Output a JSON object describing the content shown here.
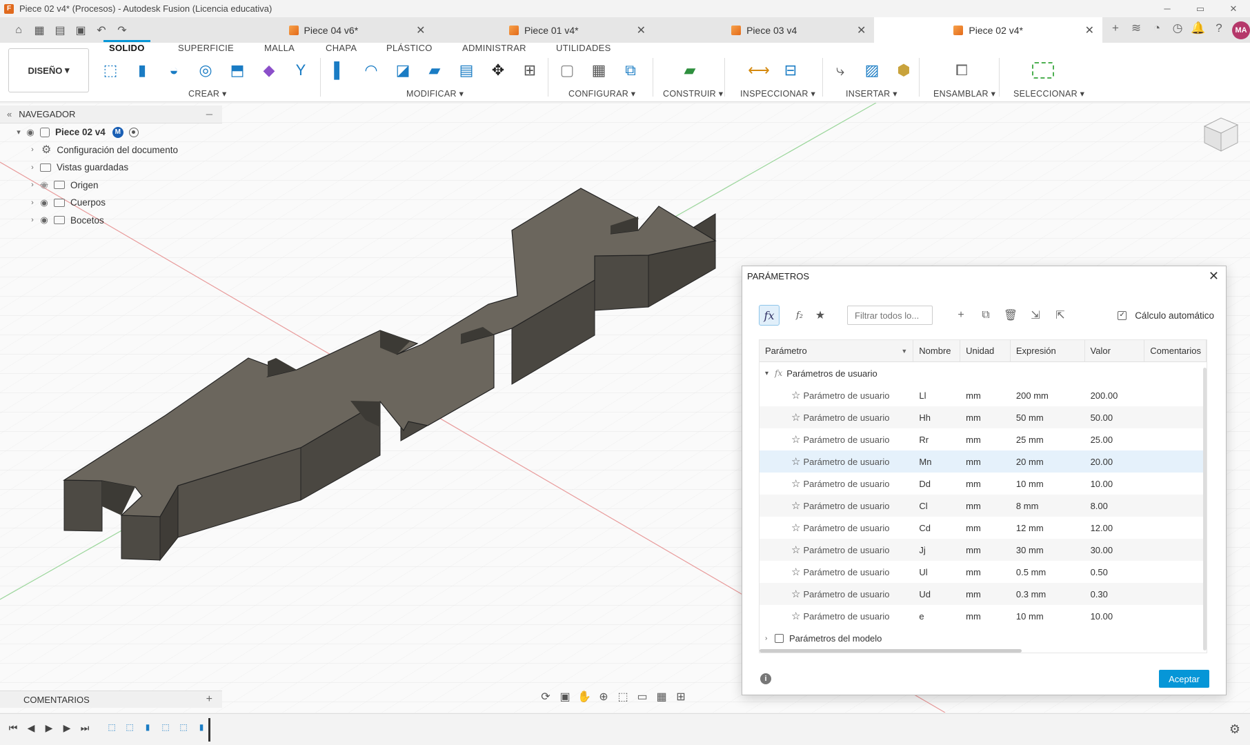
{
  "window": {
    "title": "Piece 02 v4* (Procesos) - Autodesk Fusion (Licencia educativa)",
    "min": "─",
    "max": "▭",
    "close": "✕"
  },
  "tabs": [
    {
      "label": "Piece 04 v6*"
    },
    {
      "label": "Piece 01 v4*"
    },
    {
      "label": "Piece 03 v4"
    },
    {
      "label": "Piece 02 v4*"
    }
  ],
  "user": {
    "initials": "MA"
  },
  "toolbar": {
    "workspace": "DISEÑO",
    "tabs": [
      "SOLIDO",
      "SUPERFICIE",
      "MALLA",
      "CHAPA",
      "PLÁSTICO",
      "ADMINISTRAR",
      "UTILIDADES"
    ],
    "groups": [
      "CREAR",
      "MODIFICAR",
      "CONFIGURAR",
      "CONSTRUIR",
      "INSPECCIONAR",
      "INSERTAR",
      "ENSAMBLAR",
      "SELECCIONAR"
    ]
  },
  "navigator": {
    "title": "NAVEGADOR",
    "root": "Piece 02 v4",
    "items": [
      "Configuración del documento",
      "Vistas guardadas",
      "Origen",
      "Cuerpos",
      "Bocetos"
    ]
  },
  "comments": {
    "title": "COMENTARIOS"
  },
  "dialog": {
    "title": "PARÁMETROS",
    "filter_placeholder": "Filtrar todos lo...",
    "auto_calc": "Cálculo automático",
    "columns": [
      "Parámetro",
      "Nombre",
      "Unidad",
      "Expresión",
      "Valor",
      "Comentarios"
    ],
    "group_user": "Parámetros de usuario",
    "group_model": "Parámetros del modelo",
    "rows": [
      {
        "type": "Parámetro de usuario",
        "name": "Ll",
        "unit": "mm",
        "expr": "200 mm",
        "value": "200.00"
      },
      {
        "type": "Parámetro de usuario",
        "name": "Hh",
        "unit": "mm",
        "expr": "50 mm",
        "value": "50.00"
      },
      {
        "type": "Parámetro de usuario",
        "name": "Rr",
        "unit": "mm",
        "expr": "25 mm",
        "value": "25.00"
      },
      {
        "type": "Parámetro de usuario",
        "name": "Mn",
        "unit": "mm",
        "expr": "20 mm",
        "value": "20.00"
      },
      {
        "type": "Parámetro de usuario",
        "name": "Dd",
        "unit": "mm",
        "expr": "10 mm",
        "value": "10.00"
      },
      {
        "type": "Parámetro de usuario",
        "name": "Cl",
        "unit": "mm",
        "expr": "8 mm",
        "value": "8.00"
      },
      {
        "type": "Parámetro de usuario",
        "name": "Cd",
        "unit": "mm",
        "expr": "12 mm",
        "value": "12.00"
      },
      {
        "type": "Parámetro de usuario",
        "name": "Jj",
        "unit": "mm",
        "expr": "30 mm",
        "value": "30.00"
      },
      {
        "type": "Parámetro de usuario",
        "name": "Ul",
        "unit": "mm",
        "expr": "0.5 mm",
        "value": "0.50"
      },
      {
        "type": "Parámetro de usuario",
        "name": "Ud",
        "unit": "mm",
        "expr": "0.3 mm",
        "value": "0.30"
      },
      {
        "type": "Parámetro de usuario",
        "name": "e",
        "unit": "mm",
        "expr": "10 mm",
        "value": "10.00"
      }
    ],
    "accept": "Aceptar"
  },
  "colors": {
    "accent": "#0696d7",
    "body": "#6b665d",
    "highlight_row": "#e5f1fb"
  }
}
